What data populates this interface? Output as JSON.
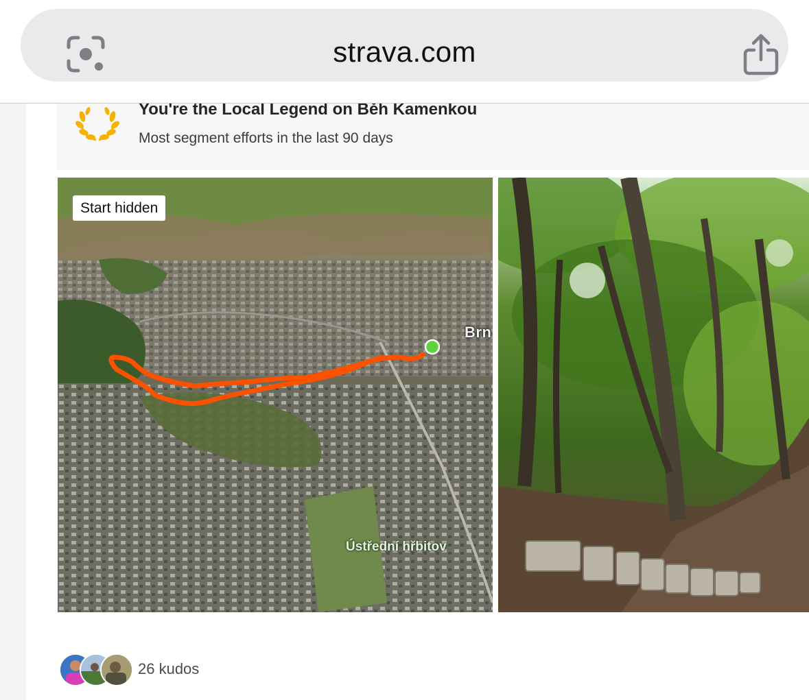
{
  "browser": {
    "url": "strava.com",
    "icons": {
      "left": "visual-search-icon",
      "right": "share-icon"
    }
  },
  "local_legend": {
    "icon": "laurel-wreath-icon",
    "title": "You're the Local Legend on Běh Kamenkou",
    "subtitle": "Most segment efforts in the last 90 days"
  },
  "map": {
    "badge": "Start hidden",
    "labels": {
      "city": "Brn",
      "cemetery": "Ústřední hřbitov"
    },
    "route_color": "#fc5200",
    "end_marker_color": "#5fd23c"
  },
  "photo": {
    "description_icon": "forest-photo"
  },
  "kudos": {
    "text": "26 kudos",
    "avatar_count": 3
  },
  "colors": {
    "accent": "#fc5200",
    "legend_gold": "#f5b301",
    "url_bar": "#e8eaec"
  }
}
